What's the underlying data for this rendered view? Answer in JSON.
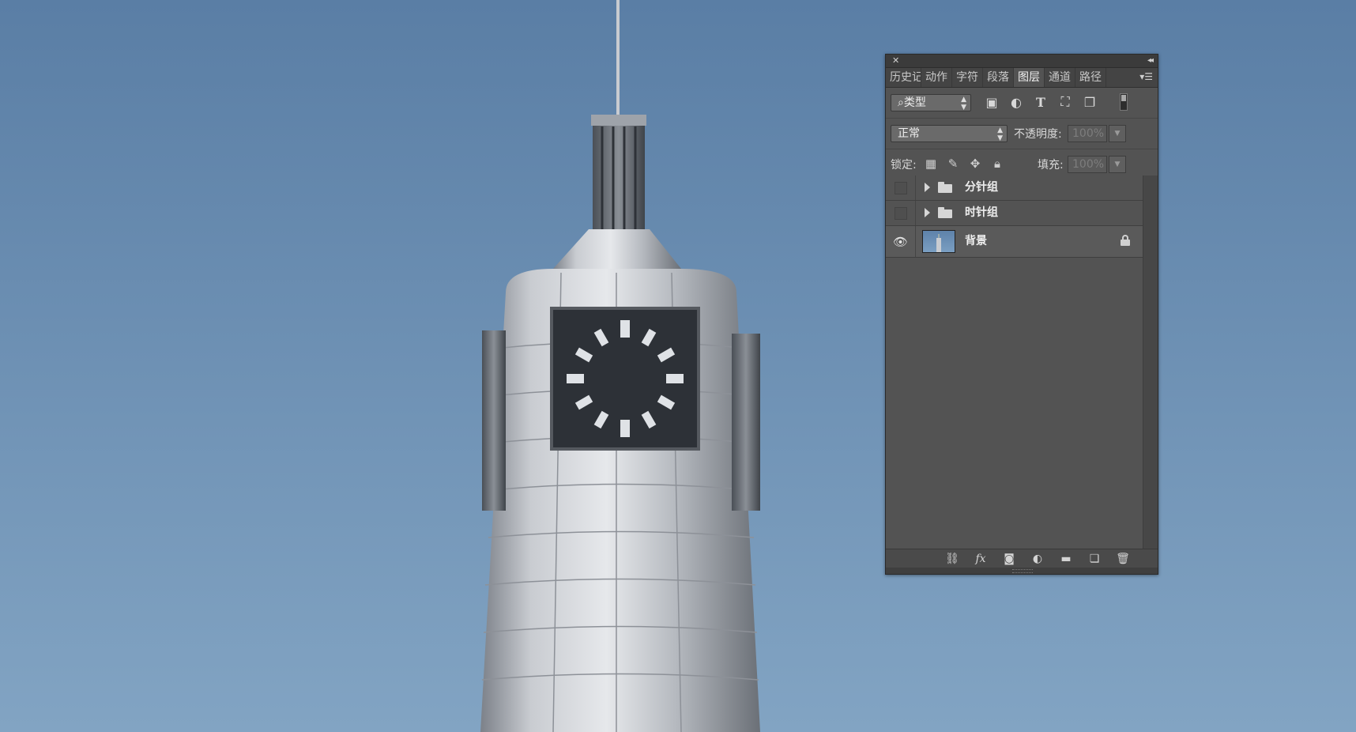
{
  "canvas": {
    "sky_top": "#5c7fa6",
    "sky_bottom": "#7fa2c2",
    "tower_metal": "#b9bcc2",
    "clock_face": "#3b3f45"
  },
  "panel": {
    "close_icon": "close-icon",
    "collapse_icon": "double-chevron-icon",
    "tabs": [
      {
        "label": "历史记录",
        "active": false
      },
      {
        "label": "动作",
        "active": false
      },
      {
        "label": "字符",
        "active": false
      },
      {
        "label": "段落",
        "active": false
      },
      {
        "label": "图层",
        "active": true
      },
      {
        "label": "通道",
        "active": false
      },
      {
        "label": "路径",
        "active": false
      }
    ],
    "filter": {
      "kind_label": "类型",
      "icons": [
        "image-filter-icon",
        "adjustment-filter-icon",
        "type-filter-icon",
        "shape-filter-icon",
        "smart-object-filter-icon"
      ]
    },
    "blend": {
      "mode": "正常",
      "opacity_label": "不透明度:",
      "opacity_value": "100%"
    },
    "lock": {
      "label": "锁定:",
      "fill_label": "填充:",
      "fill_value": "100%"
    },
    "layers": [
      {
        "name": "分针组",
        "type": "group",
        "visible": false
      },
      {
        "name": "时针组",
        "type": "group",
        "visible": false
      },
      {
        "name": "背景",
        "type": "background",
        "visible": true,
        "locked": true
      }
    ],
    "bottom_icons": [
      "link-layers-icon",
      "fx-icon",
      "mask-icon",
      "adjustment-icon",
      "new-group-icon",
      "new-layer-icon",
      "trash-icon"
    ]
  }
}
